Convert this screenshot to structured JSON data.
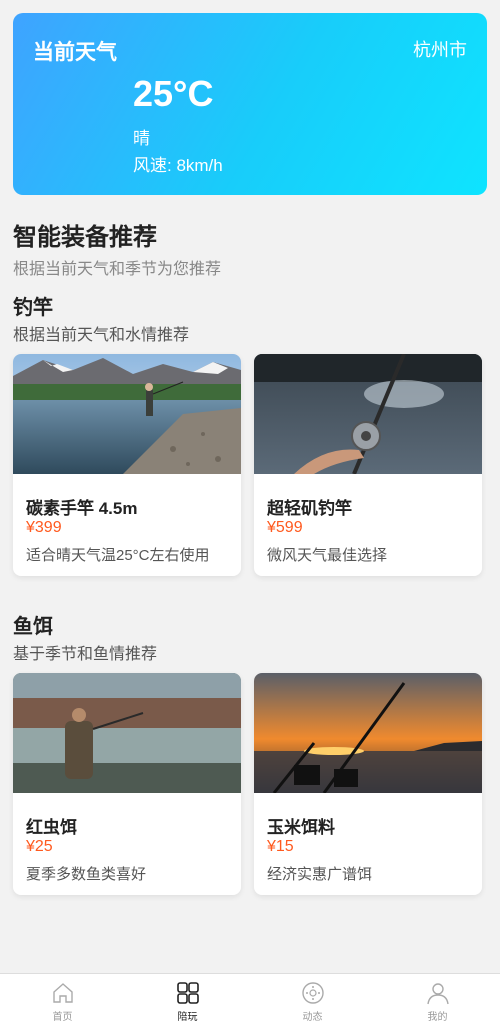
{
  "weather": {
    "title": "当前天气",
    "city": "杭州市",
    "temperature": "25°C",
    "condition": "晴",
    "wind": "风速: 8km/h"
  },
  "recommend": {
    "title": "智能装备推荐",
    "subtitle": "根据当前天气和季节为您推荐"
  },
  "categories": [
    {
      "title": "钓竿",
      "subtitle": "根据当前天气和水情推荐",
      "items": [
        {
          "name": "碳素手竿 4.5m",
          "price": "¥399",
          "desc": "适合晴天气温25°C左右使用"
        },
        {
          "name": "超轻矶钓竿",
          "price": "¥599",
          "desc": "微风天气最佳选择"
        }
      ]
    },
    {
      "title": "鱼饵",
      "subtitle": "基于季节和鱼情推荐",
      "items": [
        {
          "name": "红虫饵",
          "price": "¥25",
          "desc": "夏季多数鱼类喜好"
        },
        {
          "name": "玉米饵料",
          "price": "¥15",
          "desc": "经济实惠广谱饵"
        }
      ]
    }
  ],
  "tabbar": [
    {
      "label": "首页",
      "icon": "home-icon"
    },
    {
      "label": "陪玩",
      "icon": "grid-icon"
    },
    {
      "label": "动态",
      "icon": "moments-icon"
    },
    {
      "label": "我的",
      "icon": "user-icon"
    }
  ],
  "colors": {
    "price": "#ff5a1f",
    "weather_gradient_start": "#3fa3ff",
    "weather_gradient_end": "#0ee4ff"
  }
}
